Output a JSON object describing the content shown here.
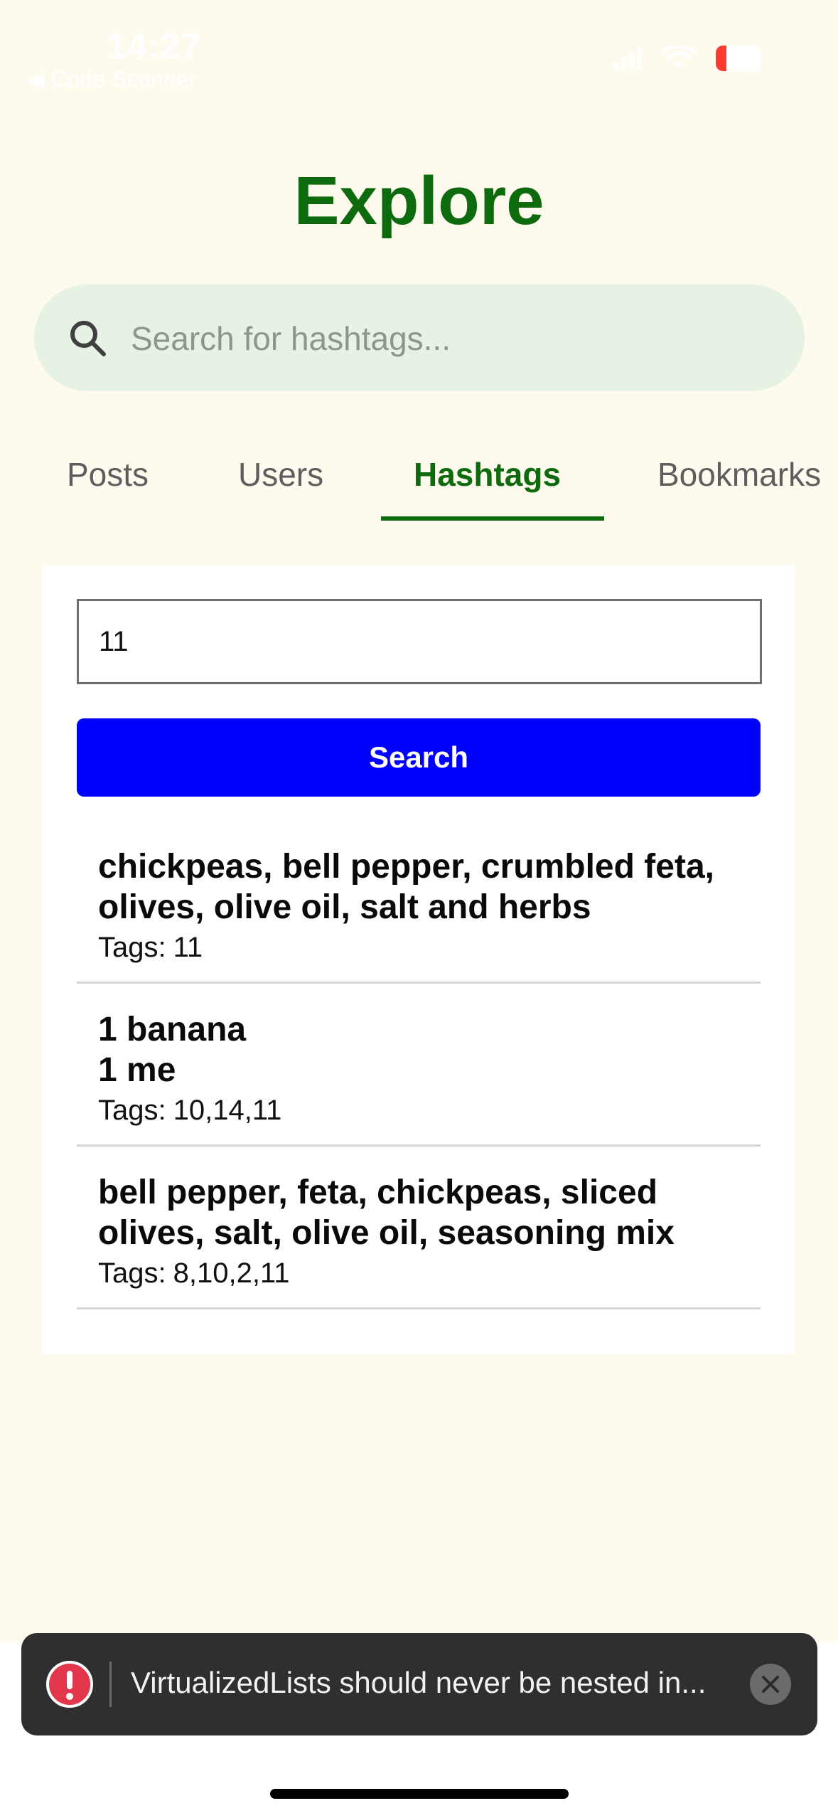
{
  "status_bar": {
    "time": "14:27",
    "back_label": "◀ Code Scanner",
    "battery_level": "23",
    "battery_fraction": 0.23
  },
  "header": {
    "title": "Explore"
  },
  "search": {
    "placeholder": "Search for hashtags..."
  },
  "tabs": [
    {
      "label": "Posts",
      "active": false
    },
    {
      "label": "Users",
      "active": false
    },
    {
      "label": "Hashtags",
      "active": true
    },
    {
      "label": "Bookmarks",
      "active": false
    }
  ],
  "hashtag_panel": {
    "input_value": "11",
    "search_button_label": "Search",
    "tags_label": "Tags:",
    "results": [
      {
        "title": "chickpeas, bell pepper, crumbled feta,\nolives, olive oil, salt and herbs",
        "tags": "11"
      },
      {
        "title": "1 banana\n1 me",
        "tags": "10,14,11"
      },
      {
        "title": "bell pepper, feta, chickpeas, sliced\nolives, salt, olive oil, seasoning mix",
        "tags": "8,10,2,11"
      }
    ]
  },
  "toast": {
    "message": "VirtualizedLists should never be nested in..."
  },
  "colors": {
    "background": "#fffaee",
    "accent": "#0d6b0d",
    "search_bg": "#e6f2e3",
    "button": "#0000ff",
    "toast_bg": "#2f2f2f",
    "error": "#e2364a"
  }
}
